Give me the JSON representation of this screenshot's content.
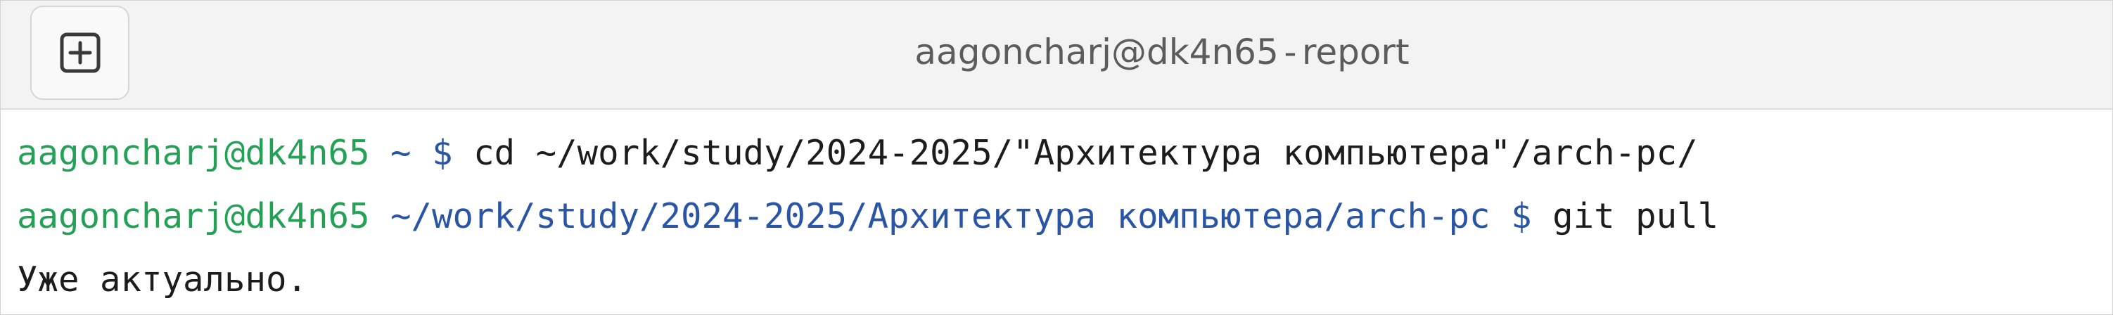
{
  "window": {
    "title_host": "aagoncharj@dk4n65",
    "title_sep": "-",
    "title_tab": "report"
  },
  "colors": {
    "user": "#25a157",
    "path": "#2a55a5",
    "text": "#1c1c1c"
  },
  "icons": {
    "new_tab": "plus-square-icon"
  },
  "terminal": {
    "lines": [
      {
        "user": "aagoncharj@dk4n65",
        "path": "~",
        "prompt": "$",
        "command": "cd ~/work/study/2024-2025/\"Архитектура компьютера\"/arch-pc/"
      },
      {
        "user": "aagoncharj@dk4n65",
        "path": "~/work/study/2024-2025/Архитектура компьютера/arch-pc",
        "prompt": "$",
        "command": "git pull"
      }
    ],
    "output": "Уже актуально."
  }
}
